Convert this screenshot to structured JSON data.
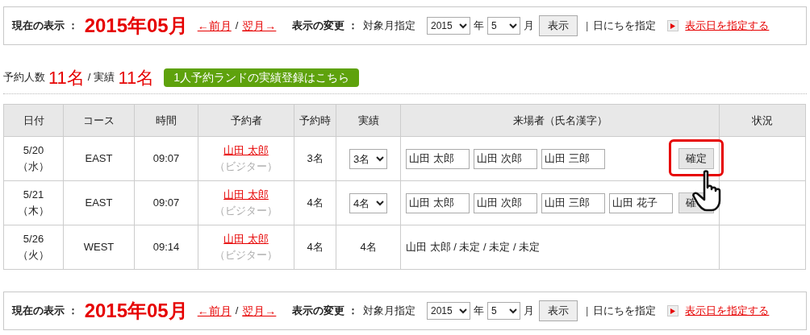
{
  "header_bars": [
    {
      "current_label": "現在の表示 ：",
      "current_month": "2015年05月",
      "prev_link": "←前月",
      "separator": "/",
      "next_link": "翌月→",
      "change_label": "表示の変更 ：",
      "target_label": "対象月指定",
      "year": "2015",
      "year_unit": "年",
      "month": "5",
      "month_unit": "月",
      "show_button": "表示",
      "divider": "|",
      "day_label": "日にちを指定",
      "day_link": "表示日を指定する"
    },
    {
      "current_label": "現在の表示 ：",
      "current_month": "2015年05月",
      "prev_link": "←前月",
      "separator": "/",
      "next_link": "翌月→",
      "change_label": "表示の変更 ：",
      "target_label": "対象月指定",
      "year": "2015",
      "year_unit": "年",
      "month": "5",
      "month_unit": "月",
      "show_button": "表示",
      "divider": "|",
      "day_label": "日にちを指定",
      "day_link": "表示日を指定する"
    }
  ],
  "summary": {
    "reserved_label": "予約人数",
    "reserved_count": "11名",
    "separator": "/",
    "actual_label": "実績",
    "actual_count": "11名",
    "register_button": "1人予約ランドの実績登録はこちら"
  },
  "table": {
    "columns": [
      "日付",
      "コース",
      "時間",
      "予約者",
      "予約時",
      "実績",
      "来場者（氏名漢字）",
      "状況"
    ],
    "rows": [
      {
        "date": "5/20",
        "weekday": "（水）",
        "course": "EAST",
        "time": "09:07",
        "reserver": "山田 太郎",
        "reserver_type": "（ビジター）",
        "reserved": "3名",
        "actual": {
          "kind": "select",
          "value": "3名"
        },
        "visitors": {
          "kind": "fields",
          "names": [
            "山田 太郎",
            "山田 次郎",
            "山田 三郎"
          ],
          "button": "確定",
          "highlighted": true
        }
      },
      {
        "date": "5/21",
        "weekday": "（木）",
        "course": "EAST",
        "time": "09:07",
        "reserver": "山田 太郎",
        "reserver_type": "（ビジター）",
        "reserved": "4名",
        "actual": {
          "kind": "select",
          "value": "4名"
        },
        "visitors": {
          "kind": "fields",
          "names": [
            "山田 太郎",
            "山田 次郎",
            "山田 三郎",
            "山田 花子"
          ],
          "button": "確",
          "highlighted": false
        }
      },
      {
        "date": "5/26",
        "weekday": "（火）",
        "course": "WEST",
        "time": "09:14",
        "reserver": "山田 太郎",
        "reserver_type": "（ビジター）",
        "reserved": "4名",
        "actual": {
          "kind": "text",
          "value": "4名"
        },
        "visitors": {
          "kind": "text",
          "text": "山田 太郎 / 未定 / 未定 / 未定"
        }
      }
    ]
  }
}
